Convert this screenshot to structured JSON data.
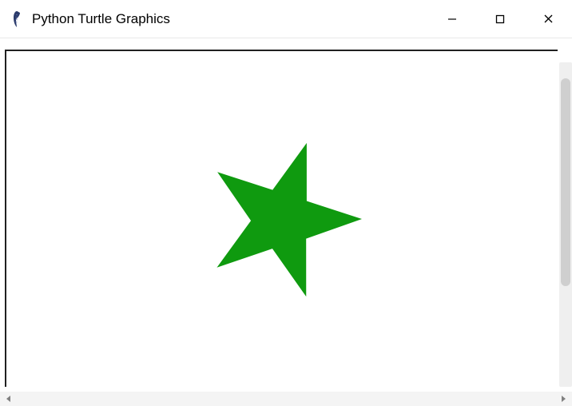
{
  "window": {
    "title": "Python Turtle Graphics",
    "icon_name": "feather-icon"
  },
  "controls": {
    "minimize": "─",
    "maximize": "☐",
    "close": "✕"
  },
  "canvas": {
    "shape": "star",
    "fill_color": "#0f9a0f",
    "points": 5,
    "rotation_deg": 18
  }
}
